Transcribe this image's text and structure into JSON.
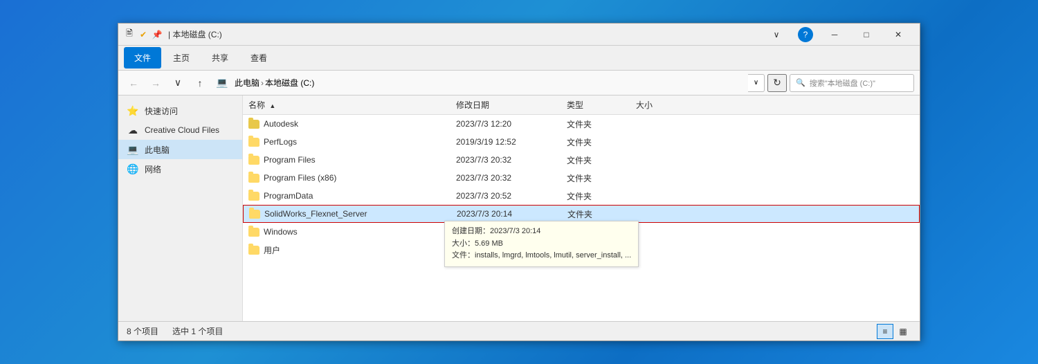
{
  "window": {
    "title": "本地磁盘 (C:)",
    "title_prefix": "| 本地磁盘 (C:)"
  },
  "ribbon": {
    "tabs": [
      "文件",
      "主页",
      "共享",
      "查看"
    ]
  },
  "address": {
    "path": "此电脑 › 本地磁盘 (C:)",
    "path_full": "此电脑 > 本地磁盘 (C:)",
    "search_placeholder": "搜索\"本地磁盘 (C:)\""
  },
  "sidebar": {
    "items": [
      {
        "label": "快速访问",
        "icon": "⭐"
      },
      {
        "label": "Creative Cloud Files",
        "icon": "☁"
      },
      {
        "label": "此电脑",
        "icon": "💻"
      },
      {
        "label": "网络",
        "icon": "🌐"
      }
    ]
  },
  "columns": {
    "name": "名称",
    "date": "修改日期",
    "type": "类型",
    "size": "大小"
  },
  "files": [
    {
      "name": "Autodesk",
      "date": "2023/7/3 12:20",
      "type": "文件夹",
      "size": "",
      "selected": false
    },
    {
      "name": "PerfLogs",
      "date": "2019/3/19 12:52",
      "type": "文件夹",
      "size": "",
      "selected": false
    },
    {
      "name": "Program Files",
      "date": "2023/7/3 20:32",
      "type": "文件夹",
      "size": "",
      "selected": false
    },
    {
      "name": "Program Files (x86)",
      "date": "2023/7/3 20:32",
      "type": "文件夹",
      "size": "",
      "selected": false
    },
    {
      "name": "ProgramData",
      "date": "2023/7/3 20:52",
      "type": "文件夹",
      "size": "",
      "selected": false
    },
    {
      "name": "SolidWorks_Flexnet_Server",
      "date": "2023/7/3 20:14",
      "type": "文件夹",
      "size": "",
      "selected": true
    },
    {
      "name": "Windows",
      "date": "",
      "type": "",
      "size": "",
      "selected": false
    },
    {
      "name": "用户",
      "date": "",
      "type": "",
      "size": "",
      "selected": false
    }
  ],
  "tooltip": {
    "created": "创建日期：2023/7/3 20:14",
    "size": "大小：5.69 MB",
    "files": "文件：installs, lmgrd, lmtools, lmutil, server_install, ..."
  },
  "status": {
    "count": "8 个项目",
    "selected": "选中 1 个项目"
  }
}
